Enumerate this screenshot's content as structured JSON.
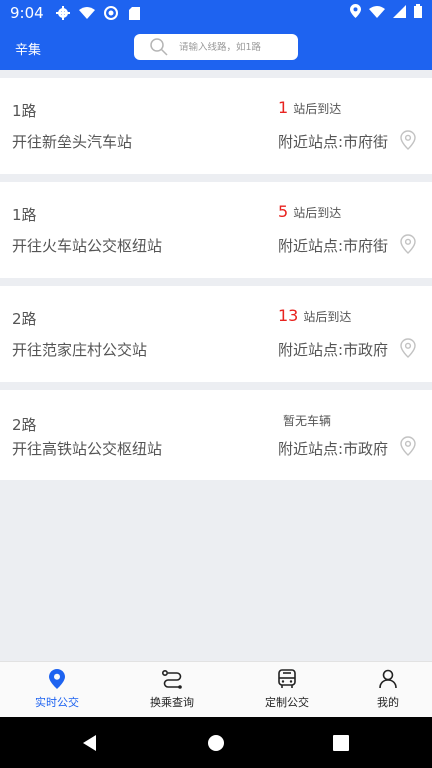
{
  "status": {
    "time": "9:04"
  },
  "header": {
    "city": "辛集",
    "search_placeholder": "请输入线路，如1路"
  },
  "cards": [
    {
      "route": "1路",
      "destination": "开往新垒头汽车站",
      "arrival_count": "1",
      "arrival_suffix": "站后到达",
      "nearby_stop": "附近站点:市府街"
    },
    {
      "route": "1路",
      "destination": "开往火车站公交枢纽站",
      "arrival_count": "5",
      "arrival_suffix": "站后到达",
      "nearby_stop": "附近站点:市府街"
    },
    {
      "route": "2路",
      "destination": "开往范家庄村公交站",
      "arrival_count": "13",
      "arrival_suffix": "站后到达",
      "nearby_stop": "附近站点:市政府"
    },
    {
      "route": "2路",
      "destination": "开往高铁站公交枢纽站",
      "arrival_count": "",
      "arrival_suffix": "暂无车辆",
      "nearby_stop": "附近站点:市政府"
    }
  ],
  "tabs": [
    {
      "label": "实时公交",
      "icon": "location-pin-icon",
      "active": true
    },
    {
      "label": "换乘查询",
      "icon": "transfer-route-icon",
      "active": false
    },
    {
      "label": "定制公交",
      "icon": "bus-icon",
      "active": false
    },
    {
      "label": "我的",
      "icon": "user-icon",
      "active": false
    }
  ],
  "colors": {
    "brand": "#1e63f0",
    "arrival": "#e8231f",
    "background": "#eceef2"
  }
}
